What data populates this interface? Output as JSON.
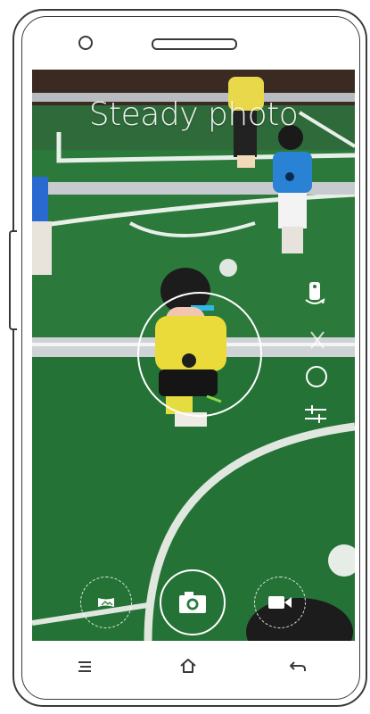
{
  "camera": {
    "mode_title": "Steady photo"
  },
  "icons": {
    "front_camera": "front-camera-icon",
    "speaker": "earpiece-speaker-icon",
    "portrait_toggle": "portrait-mode-icon",
    "flash": "flash-off-icon",
    "timer": "timer-circle-icon",
    "settings": "sliders-settings-icon",
    "panorama": "panorama-icon",
    "shutter": "camera-shutter-icon",
    "video": "video-camera-icon",
    "nav_menu": "menu-icon",
    "nav_home": "home-icon",
    "nav_back": "back-arrow-icon"
  },
  "colors": {
    "frame": "#3a3a3a",
    "overlay": "#ffffff",
    "field": "#2b7a3b"
  }
}
